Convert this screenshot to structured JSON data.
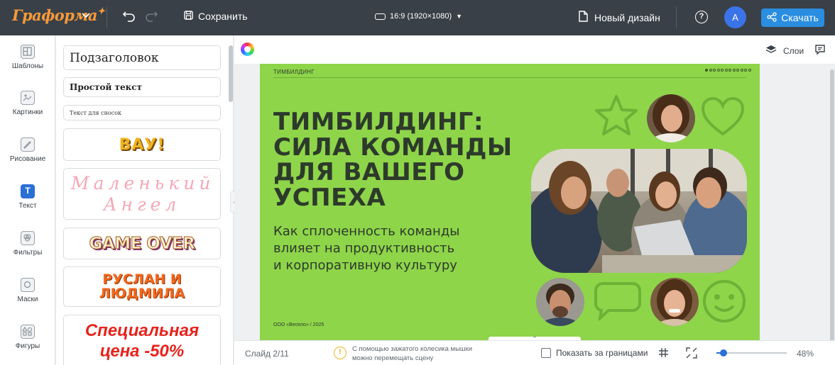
{
  "app": {
    "logo": "Граформа",
    "save_label": "Сохранить",
    "ratio_label": "16:9 (1920×1080)",
    "new_design_label": "Новый дизайн",
    "help_glyph": "?",
    "avatar_initial": "A",
    "download_label": "Скачать"
  },
  "nav": [
    {
      "label": "Шаблоны",
      "icon": "templates-icon"
    },
    {
      "label": "Картинки",
      "icon": "images-icon"
    },
    {
      "label": "Рисование",
      "icon": "draw-icon"
    },
    {
      "label": "Текст",
      "icon": "text-icon",
      "glyph": "T",
      "active": true
    },
    {
      "label": "Фильтры",
      "icon": "filters-icon"
    },
    {
      "label": "Маски",
      "icon": "masks-icon"
    },
    {
      "label": "Фигуры",
      "icon": "shapes-icon"
    }
  ],
  "text_panel": [
    {
      "text": "Подзаголовок"
    },
    {
      "text": "Простой текст"
    },
    {
      "text": "Текст для сносок"
    },
    {
      "text": "ВАУ!"
    },
    {
      "text": "Маленький Ангел"
    },
    {
      "text": "GAME OVER"
    },
    {
      "text": "РУСЛАН И ЛЮДМИЛА"
    },
    {
      "text": "Специальная цена -50%"
    }
  ],
  "toolbar": {
    "layers_label": "Слои"
  },
  "slide": {
    "header_left": "ТИМБИЛДИНГ",
    "title_lines": [
      "ТИМБИЛДИНГ:",
      "СИЛА КОМАНДЫ",
      "ДЛЯ ВАШЕГО",
      "УСПЕХА"
    ],
    "subtitle_lines": [
      "Как сплоченность команды",
      "влияет на продуктивность",
      "и корпоративную культуру"
    ],
    "footer": "ООО «Весело» / 2025",
    "dot_count": 12,
    "active_dot": 1
  },
  "bottom": {
    "slide_counter": "Слайд 2/11",
    "hint_line1": "С помощью зажатого колесика мышки",
    "hint_line2": "можно перемещать сцену",
    "show_outside_label": "Показать за границами",
    "zoom_label": "48%",
    "zoom_level": 0.1
  },
  "colors": {
    "topbar": "#3a4047",
    "accent": "#2a8de0",
    "slide_bg": "#8ed54a",
    "slide_text": "#2d3a2b"
  }
}
